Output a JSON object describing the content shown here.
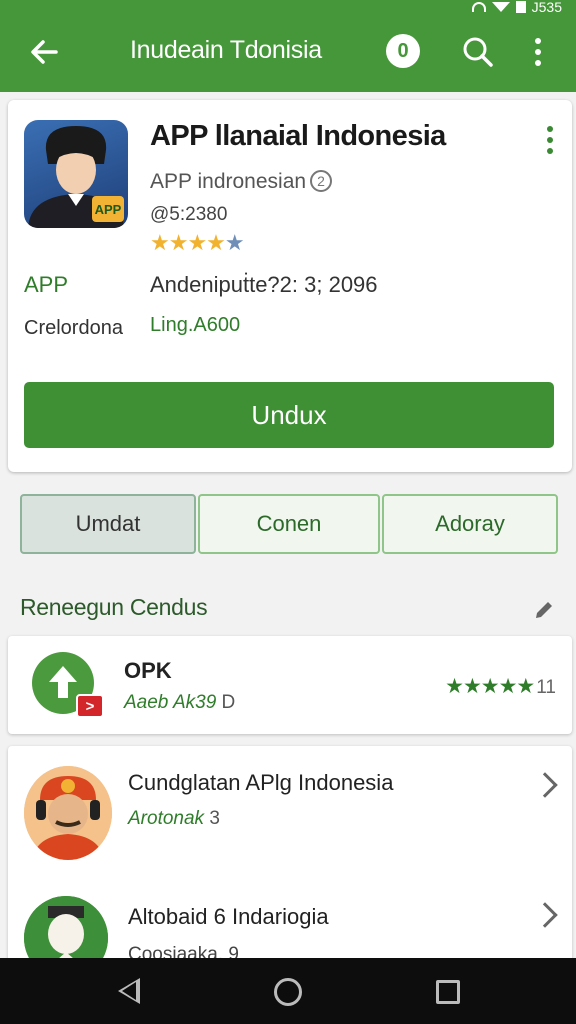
{
  "status_bar": {
    "time": "J535"
  },
  "app_bar": {
    "title": "Inudeain Tdonisia",
    "circle_icon_text": "0",
    "icons": [
      "back-arrow-icon",
      "circle-icon",
      "search-icon",
      "more-vert-icon"
    ]
  },
  "app": {
    "name": "APP llanaial Indonesia",
    "developer": "APP indronesian",
    "developer_info": "2",
    "downloads": "@5:2380",
    "rating_stars": 4,
    "rating_max": 5,
    "icon_badge": "APP",
    "meta": [
      {
        "key": "APP",
        "value": "Andenipuṫte?2: 3; 2096"
      },
      {
        "key": "Crelordona",
        "value": "Ling.A600"
      }
    ],
    "install_label": "Undux",
    "colors": {
      "primary": "#46963a",
      "button": "#3f8f35",
      "star": "#f1b22f"
    }
  },
  "tabs": [
    {
      "label": "Umdat",
      "active": true
    },
    {
      "label": "Conen",
      "active": false
    },
    {
      "label": "Adoray",
      "active": false
    }
  ],
  "section": {
    "title": "Reneegun Cendus"
  },
  "list": [
    {
      "name": "OPK",
      "sub": "Aaeb",
      "sub_tag": "Ak39",
      "sub_suffix": "D",
      "stars": "★★★★★",
      "rating": "11",
      "badge": ">"
    },
    {
      "name": "Cundglatan APlg Indonesia",
      "sub": "Arotonak",
      "sub_tag": "3"
    },
    {
      "name": "Altobaid 6 Indariogia",
      "sub": "Coosiaaka. 9"
    }
  ]
}
